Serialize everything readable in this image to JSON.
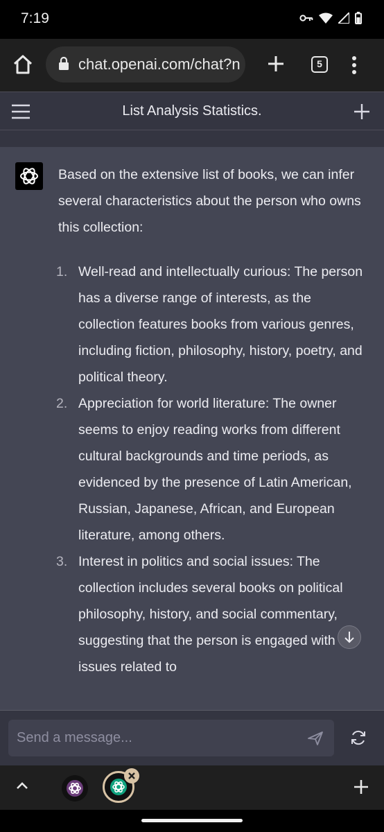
{
  "status_bar": {
    "time": "7:19"
  },
  "browser": {
    "url": "chat.openai.com/chat?n",
    "tab_count": "5"
  },
  "app_bar": {
    "title": "List Analysis Statistics."
  },
  "message": {
    "intro": "Based on the extensive list of books, we can infer several characteristics about the person who owns this collection:",
    "items": [
      {
        "num": "1.",
        "text": "Well-read and intellectually curious: The person has a diverse range of interests, as the collection features books from various genres, including fiction, philosophy, history, poetry, and political theory."
      },
      {
        "num": "2.",
        "text": "Appreciation for world literature: The owner seems to enjoy reading works from different cultural backgrounds and time periods, as evidenced by the presence of Latin American, Russian, Japanese, African, and European literature, among others."
      },
      {
        "num": "3.",
        "text": "Interest in politics and social issues: The collection includes several books on political philosophy, history, and social commentary, suggesting that the person is engaged with issues related to"
      }
    ]
  },
  "composer": {
    "placeholder": "Send a message..."
  },
  "colors": {
    "chat_bg": "#444654",
    "app_bg": "#343541",
    "input_bg": "#40414f",
    "browser_bg": "#1f1f1f",
    "tab_ring": "#d8c3a5"
  }
}
